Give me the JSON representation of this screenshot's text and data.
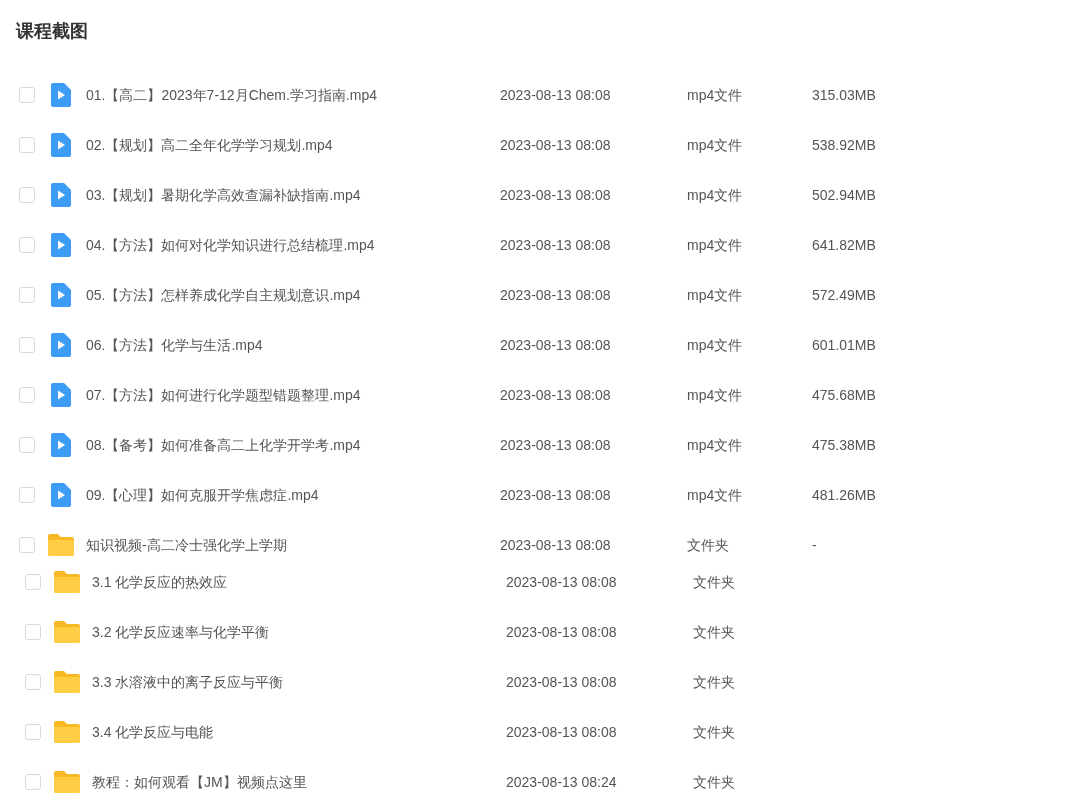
{
  "title": "课程截图",
  "items": [
    {
      "kind": "video",
      "name": "01.【高二】2023年7-12月Chem.学习指南.mp4",
      "modified": "2023-08-13 08:08",
      "type": "mp4文件",
      "size": "315.03MB",
      "checked": false
    },
    {
      "kind": "video",
      "name": "02.【规划】高二全年化学学习规划.mp4",
      "modified": "2023-08-13 08:08",
      "type": "mp4文件",
      "size": "538.92MB",
      "checked": false
    },
    {
      "kind": "video",
      "name": "03.【规划】暑期化学高效查漏补缺指南.mp4",
      "modified": "2023-08-13 08:08",
      "type": "mp4文件",
      "size": "502.94MB",
      "checked": false
    },
    {
      "kind": "video",
      "name": "04.【方法】如何对化学知识进行总结梳理.mp4",
      "modified": "2023-08-13 08:08",
      "type": "mp4文件",
      "size": "641.82MB",
      "checked": false
    },
    {
      "kind": "video",
      "name": "05.【方法】怎样养成化学自主规划意识.mp4",
      "modified": "2023-08-13 08:08",
      "type": "mp4文件",
      "size": "572.49MB",
      "checked": false
    },
    {
      "kind": "video",
      "name": "06.【方法】化学与生活.mp4",
      "modified": "2023-08-13 08:08",
      "type": "mp4文件",
      "size": "601.01MB",
      "checked": false
    },
    {
      "kind": "video",
      "name": "07.【方法】如何进行化学题型错题整理.mp4",
      "modified": "2023-08-13 08:08",
      "type": "mp4文件",
      "size": "475.68MB",
      "checked": false
    },
    {
      "kind": "video",
      "name": "08.【备考】如何准备高二上化学开学考.mp4",
      "modified": "2023-08-13 08:08",
      "type": "mp4文件",
      "size": "475.38MB",
      "checked": false
    },
    {
      "kind": "video",
      "name": "09.【心理】如何克服开学焦虑症.mp4",
      "modified": "2023-08-13 08:08",
      "type": "mp4文件",
      "size": "481.26MB",
      "checked": false
    },
    {
      "kind": "folder",
      "name": "知识视频-高二冷士强化学上学期",
      "modified": "2023-08-13 08:08",
      "type": "文件夹",
      "size": "-",
      "checked": false,
      "children": [
        {
          "kind": "folder",
          "name": "3.1 化学反应的热效应",
          "modified": "2023-08-13 08:08",
          "type": "文件夹",
          "checked": false
        },
        {
          "kind": "folder",
          "name": "3.2 化学反应速率与化学平衡",
          "modified": "2023-08-13 08:08",
          "type": "文件夹",
          "checked": false
        },
        {
          "kind": "folder",
          "name": "3.3 水溶液中的离子反应与平衡",
          "modified": "2023-08-13 08:08",
          "type": "文件夹",
          "checked": false
        },
        {
          "kind": "folder",
          "name": "3.4 化学反应与电能",
          "modified": "2023-08-13 08:08",
          "type": "文件夹",
          "checked": false
        },
        {
          "kind": "folder",
          "name": "教程：如何观看【JM】视频点这里",
          "modified": "2023-08-13 08:24",
          "type": "文件夹",
          "checked": false
        }
      ]
    }
  ]
}
